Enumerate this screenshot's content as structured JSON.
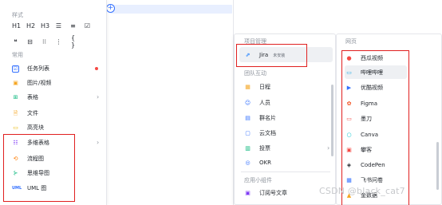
{
  "editor": {
    "add_symbol": "+"
  },
  "panel_left": {
    "style_title": "样式",
    "format_row1": [
      "H1",
      "H2",
      "H3",
      "☰",
      "≡",
      "☑"
    ],
    "format_row2": [
      "❝",
      "⊟",
      "⁝⁝",
      "⋮",
      "{ }"
    ],
    "common_title": "常用",
    "items": [
      {
        "label": "任务列表",
        "color": "#3370ff",
        "glyph": "☑"
      },
      {
        "label": "图片/视频",
        "color": "#f5a623",
        "glyph": "▣"
      },
      {
        "label": "表格",
        "color": "#00b578",
        "glyph": "⊞"
      },
      {
        "label": "文件",
        "color": "#f5a623",
        "glyph": "🗎"
      },
      {
        "label": "高亮块",
        "color": "#f7d25a",
        "glyph": "▭"
      },
      {
        "label": "多维表格",
        "color": "#7f3bf5",
        "glyph": "☷"
      },
      {
        "label": "流程图",
        "color": "#ff7d00",
        "glyph": "⟲"
      },
      {
        "label": "思维导图",
        "color": "#00b578",
        "glyph": "⊱"
      },
      {
        "label": "UML 图",
        "color": "#3370ff",
        "glyph": "UML"
      }
    ]
  },
  "panel_mid": {
    "project_title": "项目管理",
    "jira_label": "Jira",
    "jira_badge": "未安装",
    "team_title": "团队互动",
    "items": [
      {
        "label": "日程",
        "color": "#f5a623",
        "glyph": "▦"
      },
      {
        "label": "人员",
        "color": "#3370ff",
        "glyph": "☺"
      },
      {
        "label": "群名片",
        "color": "#3370ff",
        "glyph": "▤"
      },
      {
        "label": "云文档",
        "color": "#3370ff",
        "glyph": "▢"
      },
      {
        "label": "投票",
        "color": "#00b578",
        "glyph": "▥"
      },
      {
        "label": "OKR",
        "color": "#3370ff",
        "glyph": "◎"
      }
    ],
    "widget_title": "应用小组件",
    "widget_item": {
      "label": "订阅号文章",
      "color": "#7f3bf5",
      "glyph": "▣"
    }
  },
  "panel_right": {
    "web_title": "网页",
    "items": [
      {
        "label": "西瓜视频",
        "color": "#f54a45",
        "glyph": "●"
      },
      {
        "label": "哔哩哔哩",
        "color": "#23ade5",
        "glyph": "▭"
      },
      {
        "label": "优酷视频",
        "color": "#3370ff",
        "glyph": "▶"
      },
      {
        "label": "Figma",
        "color": "#f24e1e",
        "glyph": "✿"
      },
      {
        "label": "墨刀",
        "color": "#f54a45",
        "glyph": "▭"
      },
      {
        "label": "Canva",
        "color": "#00c4cc",
        "glyph": "○"
      },
      {
        "label": "攀客",
        "color": "#f54a45",
        "glyph": "▣"
      },
      {
        "label": "CodePen",
        "color": "#1f2329",
        "glyph": "◈"
      },
      {
        "label": "飞书问卷",
        "color": "#3370ff",
        "glyph": "▦"
      },
      {
        "label": "金数据",
        "color": "#f5a623",
        "glyph": "▲"
      }
    ]
  },
  "watermark": "CSDN @black_cat7"
}
